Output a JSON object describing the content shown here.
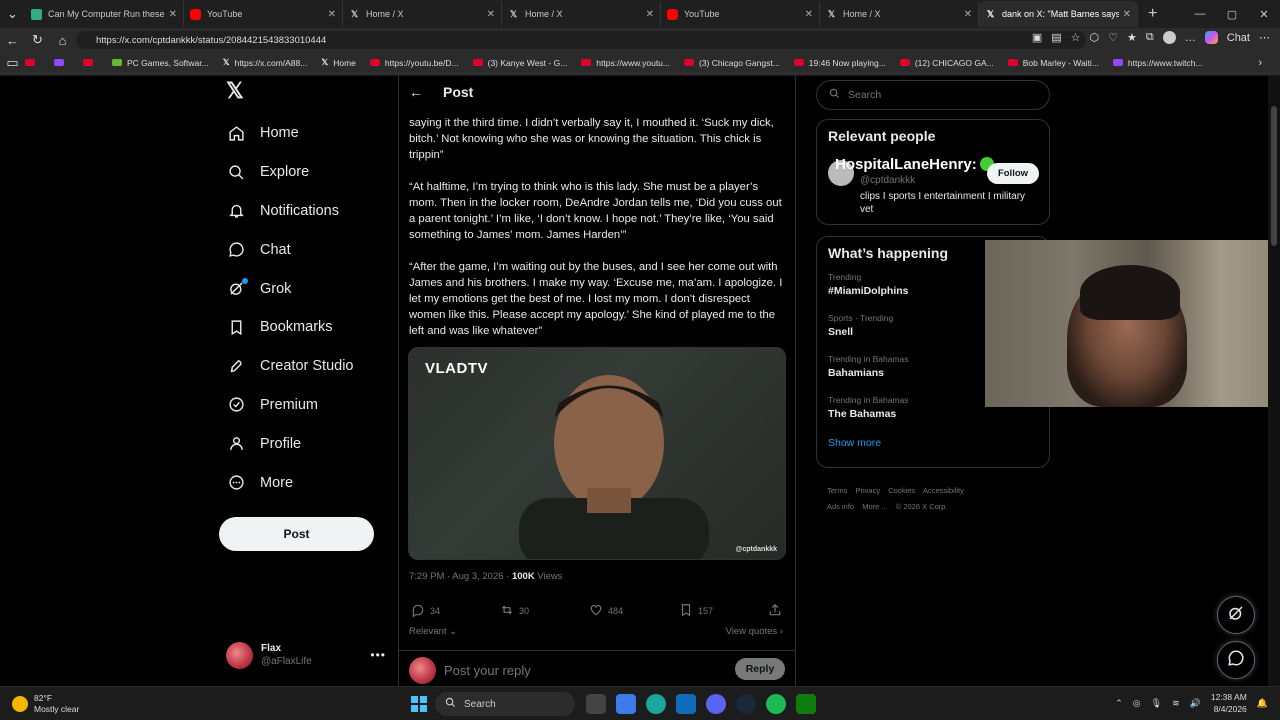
{
  "browser": {
    "tabs": [
      {
        "title": "Can My Computer Run these gam",
        "icon": "green-square-icon"
      },
      {
        "title": "YouTube",
        "icon": "youtube-icon"
      },
      {
        "title": "Home / X",
        "icon": "x-icon"
      },
      {
        "title": "Home / X",
        "icon": "x-icon"
      },
      {
        "title": "YouTube",
        "icon": "youtube-icon"
      },
      {
        "title": "Home / X",
        "icon": "x-icon"
      },
      {
        "title": "dank on X: \"Matt Barnes says",
        "icon": "x-icon",
        "active": true
      }
    ],
    "url": "https://x.com/cptdankkk/status/2084421543833010444",
    "chat_label": "Chat",
    "bookmarks": [
      {
        "label": ""
      },
      {
        "label": ""
      },
      {
        "label": ""
      },
      {
        "label": "PC Games, Softwar..."
      },
      {
        "label": "https://x.com/A88..."
      },
      {
        "label": "Home"
      },
      {
        "label": "https://youtu.be/D..."
      },
      {
        "label": "(3) Kanye West - G..."
      },
      {
        "label": "https://www.youtu..."
      },
      {
        "label": "(3) Chicago Gangst..."
      },
      {
        "label": "19:46 Now playing..."
      },
      {
        "label": "(12) CHICAGO GA..."
      },
      {
        "label": "Bob Marley - Waiti..."
      },
      {
        "label": "https://www.twitch..."
      }
    ]
  },
  "nav": {
    "items": [
      {
        "label": "Home",
        "icon": "home-icon"
      },
      {
        "label": "Explore",
        "icon": "search-icon"
      },
      {
        "label": "Notifications",
        "icon": "bell-icon"
      },
      {
        "label": "Chat",
        "icon": "chat-icon"
      },
      {
        "label": "Grok",
        "icon": "grok-icon"
      },
      {
        "label": "Bookmarks",
        "icon": "bookmark-icon"
      },
      {
        "label": "Creator Studio",
        "icon": "rocket-icon"
      },
      {
        "label": "Premium",
        "icon": "verified-icon"
      },
      {
        "label": "Profile",
        "icon": "person-icon"
      },
      {
        "label": "More",
        "icon": "more-circle-icon"
      }
    ],
    "post_label": "Post",
    "account": {
      "name": "Flax",
      "handle": "@aFlaxLife"
    }
  },
  "post": {
    "header_title": "Post",
    "paragraphs": [
      "saying it the third time. I didn’t verbally say it, I mouthed it. ‘Suck my dick, bitch.’ Not knowing who she was or knowing the situation. This chick is trippin”",
      "“At halftime, I’m trying to think who is this lady. She must be a player’s mom. Then in the locker room, DeAndre Jordan tells me, ‘Did you cuss out a parent tonight.’ I’m like, ‘I don’t know. I hope not.’ They’re like, ‘You said something to James’ mom. James Harden’”",
      "“After the game, I’m waiting out by the buses, and I see her come out with James and his brothers. I make my way. ‘Excuse me, ma’am. I apologize. I let my emotions get the best of me. I lost my mom. I don’t disrespect women like this. Please accept my apology.’ She kind of played me to the left and was like whatever”"
    ],
    "media_brand": "VLADTV",
    "media_watermark": "@cptdankkk",
    "time": "7:29 PM · Aug 3, 2026 · ",
    "views_count": "100K",
    "views_label": " Views",
    "replies": "34",
    "reposts": "30",
    "likes": "484",
    "bookmarks": "157",
    "relevant_label": "Relevant",
    "view_quotes_label": "View quotes",
    "reply_placeholder": "Post your reply",
    "reply_button": "Reply"
  },
  "sidebar": {
    "search_placeholder": "Search",
    "relevant_title": "Relevant people",
    "person": {
      "name": "HospitalLaneHenry:",
      "handle": "@cptdankkk",
      "follow": "Follow",
      "bio": "clips I sports I entertainment I military vet"
    },
    "happening_title": "What’s happening",
    "trends": [
      {
        "category": "Trending",
        "name": "#MiamiDolphins"
      },
      {
        "category": "Sports · Trending",
        "name": "Snell"
      },
      {
        "category": "Trending in Bahamas",
        "name": "Bahamians"
      },
      {
        "category": "Trending in Bahamas",
        "name": "The Bahamas"
      }
    ],
    "show_more": "Show more",
    "footer_links": [
      "Terms",
      "Privacy",
      "Cookies",
      "Accessibility",
      "Ads info",
      "More ...",
      "© 2026 X Corp."
    ]
  },
  "taskbar": {
    "temp": "82°F",
    "weather": "Mostly clear",
    "search": "Search",
    "time": "12:38 AM",
    "date": "8/4/2026"
  },
  "colors": {
    "accent": "#1d9bf0",
    "background": "#000000",
    "text": "#e7e9ea",
    "muted": "#71767b"
  }
}
